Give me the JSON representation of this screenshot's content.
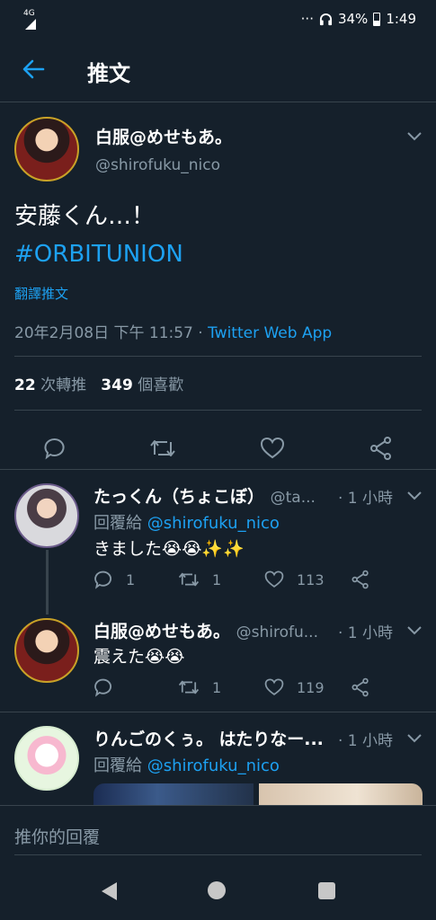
{
  "status": {
    "network": "4G",
    "dots": "···",
    "battery": "34%",
    "time": "1:49"
  },
  "header": {
    "title": "推文"
  },
  "tweet": {
    "author_name": "白服@めせもあ。",
    "author_handle": "@shirofuku_nico",
    "text": "安藤くん…！",
    "hashtag": "#ORBITUNION",
    "translate": "翻譯推文",
    "date": "20年2月08日 下午 11:57 · ",
    "source": "Twitter Web App",
    "retweets": "22",
    "retweets_label": "次轉推",
    "likes": "349",
    "likes_label": "個喜歡"
  },
  "replies": [
    {
      "name": "たっくん（ちょこぼ）",
      "handle": "@ta...",
      "time": "· 1 小時",
      "replying_prefix": "回覆給 ",
      "replying_to": "@shirofuku_nico",
      "text": "きました😭😭✨✨",
      "reply_count": "1",
      "retweet_count": "1",
      "like_count": "113"
    },
    {
      "name": "白服@めせもあ。",
      "handle": "@shirofu...",
      "time": "· 1 小時",
      "text": "震えた😭😭",
      "reply_count": "",
      "retweet_count": "1",
      "like_count": "119"
    },
    {
      "name": "りんごのくぅ。 はたりなー...",
      "time": "· 1 小時",
      "replying_prefix": "回覆給 ",
      "replying_to": "@shirofuku_nico"
    }
  ],
  "reply_bar": {
    "placeholder": "推你的回覆"
  },
  "colors": {
    "background": "#15202b",
    "accent": "#1da1f2",
    "muted": "#8899a6",
    "border": "#38444d"
  }
}
